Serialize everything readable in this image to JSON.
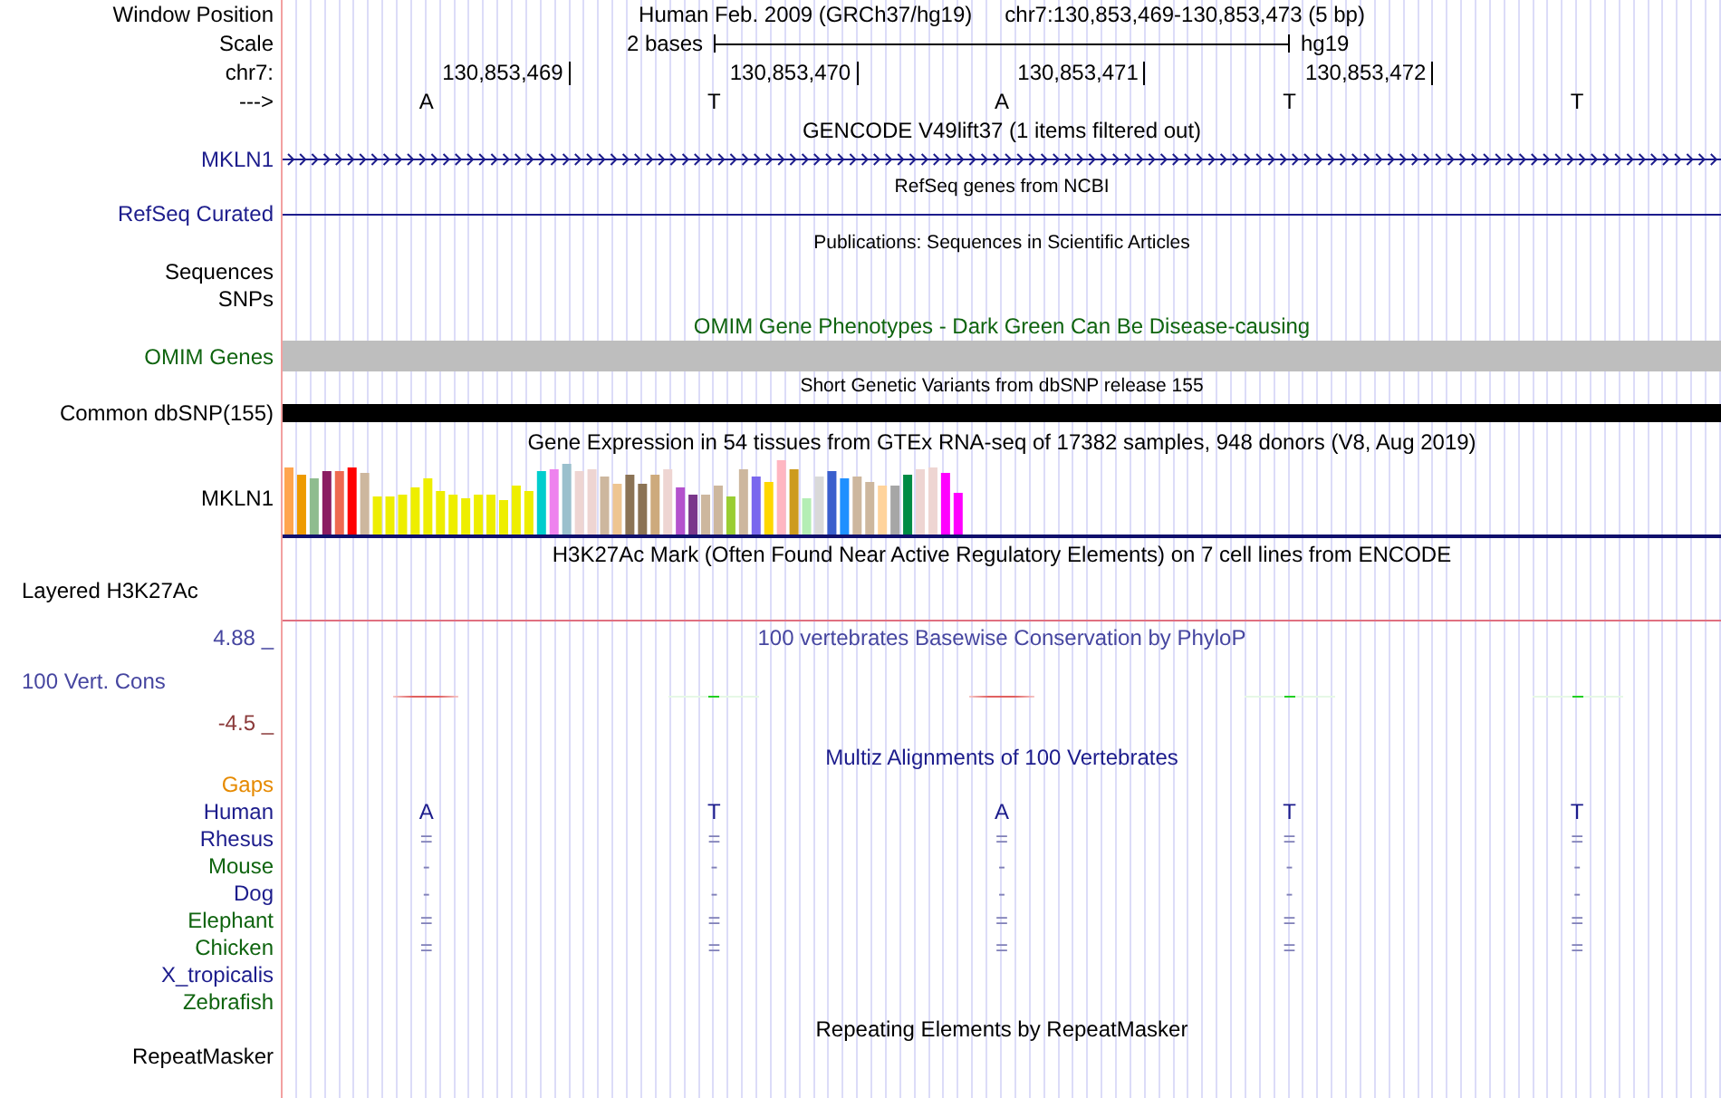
{
  "position": {
    "label": "Window Position",
    "assembly": "Human Feb. 2009 (GRCh37/hg19)",
    "range": "chr7:130,853,469-130,853,473 (5 bp)"
  },
  "scale": {
    "label": "Scale",
    "length": "2 bases",
    "assembly": "hg19"
  },
  "ruler": {
    "label": "chr7:",
    "positions": [
      "130,853,469",
      "130,853,470",
      "130,853,471",
      "130,853,472"
    ]
  },
  "bases": {
    "label": "--->",
    "letters": [
      "A",
      "T",
      "A",
      "T",
      "T"
    ]
  },
  "tracks": [
    {
      "kind": "gene",
      "title": "GENCODE V49lift37 (1 items filtered out)",
      "label": "MKLN1",
      "color": "#1c1c8c"
    },
    {
      "kind": "line",
      "title": "RefSeq genes from NCBI",
      "label": "RefSeq Curated",
      "color": "#1c1c8c"
    },
    {
      "kind": "empty",
      "title": "Publications: Sequences in Scientific Articles",
      "labels": [
        "Sequences",
        "SNPs"
      ]
    },
    {
      "kind": "shaded",
      "title": "OMIM Gene Phenotypes - Dark Green Can Be Disease-causing",
      "label": "OMIM Genes",
      "color": "#0f640f"
    },
    {
      "kind": "solid",
      "title": "Short Genetic Variants from dbSNP release 155",
      "label": "Common dbSNP(155)"
    },
    {
      "kind": "expression",
      "title": "Gene Expression in 54 tissues from GTEx RNA-seq of 17382 samples, 948 donors (V8, Aug 2019)",
      "label": "MKLN1"
    },
    {
      "kind": "layered",
      "title": "H3K27Ac Mark (Often Found Near Active Regulatory Elements) on 7 cell lines from ENCODE",
      "label": "Layered H3K27Ac"
    },
    {
      "kind": "wiggle",
      "title": "100 vertebrates Basewise Conservation by PhyloP",
      "label": "100 Vert. Cons",
      "max": "4.88 _",
      "min": "-4.5 _",
      "color": "#4646a0"
    },
    {
      "kind": "alignment",
      "title": "Multiz Alignments of 100 Vertebrates",
      "gaps": "Gaps",
      "species": [
        {
          "name": "Human",
          "color": "#1c1c8c",
          "symbols": [
            "A",
            "T",
            "A",
            "T",
            "T"
          ]
        },
        {
          "name": "Rhesus",
          "color": "#1c1c8c",
          "symbols": [
            "=",
            "=",
            "=",
            "=",
            "="
          ]
        },
        {
          "name": "Mouse",
          "color": "#0f640f",
          "symbols": [
            "-",
            "-",
            "-",
            "-",
            "-"
          ]
        },
        {
          "name": "Dog",
          "color": "#1c1c8c",
          "symbols": [
            "-",
            "-",
            "-",
            "-",
            "-"
          ]
        },
        {
          "name": "Elephant",
          "color": "#0f640f",
          "symbols": [
            "=",
            "=",
            "=",
            "=",
            "="
          ]
        },
        {
          "name": "Chicken",
          "color": "#0f640f",
          "symbols": [
            "=",
            "=",
            "=",
            "=",
            "="
          ]
        },
        {
          "name": "X_tropicalis",
          "color": "#1c1c8c"
        },
        {
          "name": "Zebrafish",
          "color": "#0f640f"
        }
      ]
    },
    {
      "kind": "repeats",
      "title": "Repeating Elements by RepeatMasker",
      "label": "RepeatMasker"
    }
  ]
}
